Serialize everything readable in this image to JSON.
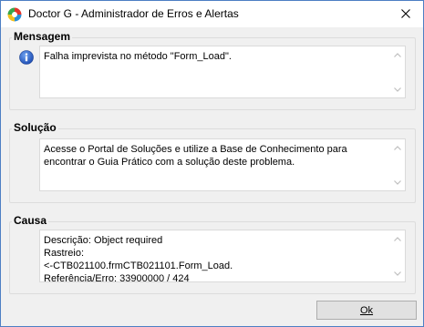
{
  "window": {
    "title": "Doctor G - Administrador de Erros e Alertas",
    "close_label": "✕"
  },
  "mensagem": {
    "group_label": "Mensagem",
    "text": "Falha imprevista no método \"Form_Load\".",
    "icon": "info-icon"
  },
  "solucao": {
    "group_label": "Solução",
    "text": "Acesse o Portal de Soluções e utilize a Base de Conhecimento para encontrar o Guia Prático com a solução deste problema."
  },
  "causa": {
    "group_label": "Causa",
    "text": "Descrição: Object required\nRastreio:\n<-CTB021100.frmCTB021101.Form_Load.\nReferência/Erro: 33900000 / 424"
  },
  "footer": {
    "ok_label": "Ok"
  },
  "colors": {
    "border_accent": "#4d7fc4",
    "info_blue": "#2b63c7"
  }
}
